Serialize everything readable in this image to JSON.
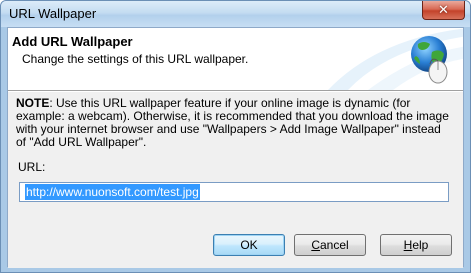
{
  "window": {
    "title": "URL Wallpaper",
    "close_glyph": "✕"
  },
  "header": {
    "title": "Add URL Wallpaper",
    "subtitle": "Change the settings of this URL wallpaper.",
    "icon": "globe-with-mouse-icon"
  },
  "note": {
    "label": "NOTE",
    "text": ": Use this URL wallpaper feature if your online image is dynamic (for example: a webcam). Otherwise, it is recommended that you download the image with your internet browser and use \"Wallpapers > Add Image Wallpaper\" instead of \"Add URL Wallpaper\"."
  },
  "url": {
    "label": "URL:",
    "value": "http://www.nuonsoft.com/test.jpg"
  },
  "buttons": {
    "ok": "OK",
    "cancel_first": "C",
    "cancel_rest": "ancel",
    "help_first": "H",
    "help_rest": "elp"
  },
  "colors": {
    "selection": "#3399ff",
    "close_button": "#c4432b",
    "default_button_border": "#3c7fb1"
  }
}
